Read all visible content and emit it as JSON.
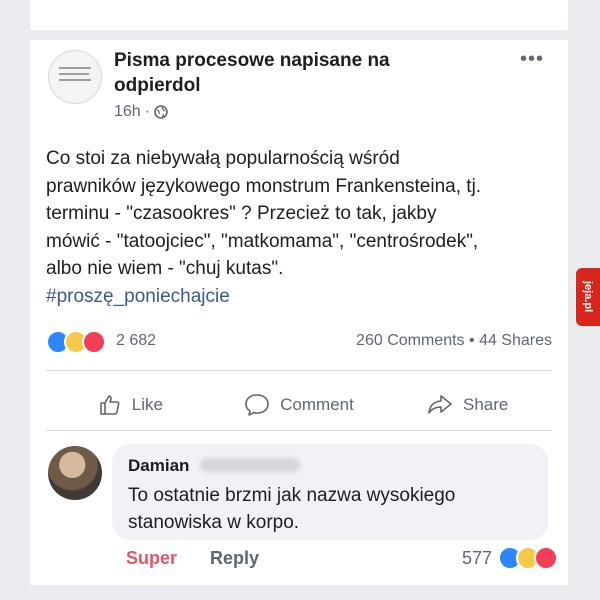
{
  "post": {
    "page_name": "Pisma procesowe napisane na odpierdol",
    "time": "16h",
    "separator": "·",
    "more": "•••",
    "text_line1": "Co stoi za niebywałą popularnością wśród",
    "text_line2": "prawników językowego monstrum Frankensteina, tj.",
    "text_line3": "terminu - \"czasookres\" ? Przecież to tak, jakby",
    "text_line4": "mówić - \"tatoojciec\", \"matkomama\", \"centrośrodek\",",
    "text_line5": "albo nie wiem - \"chuj kutas\".",
    "hashtag": "#proszę_poniechajcie"
  },
  "reactions": {
    "count": "2 682",
    "comments": "260 Comments",
    "dot": "•",
    "shares": "44 Shares",
    "icons": [
      "like-reaction-icon",
      "haha-reaction-icon",
      "love-reaction-icon"
    ]
  },
  "actions": {
    "like": "Like",
    "comment": "Comment",
    "share": "Share"
  },
  "comment": {
    "author": "Damian",
    "text_line1": "To ostatnie brzmi jak nazwa wysokiego",
    "text_line2": "stanowiska w korpo.",
    "super": "Super",
    "reply": "Reply",
    "reaction_count": "577"
  },
  "watermark": "jeja.pl",
  "colors": {
    "accent": "#385898",
    "super": "#e0566b",
    "like": "#2d86ff",
    "love": "#f33e58",
    "haha": "#f7c94a"
  }
}
